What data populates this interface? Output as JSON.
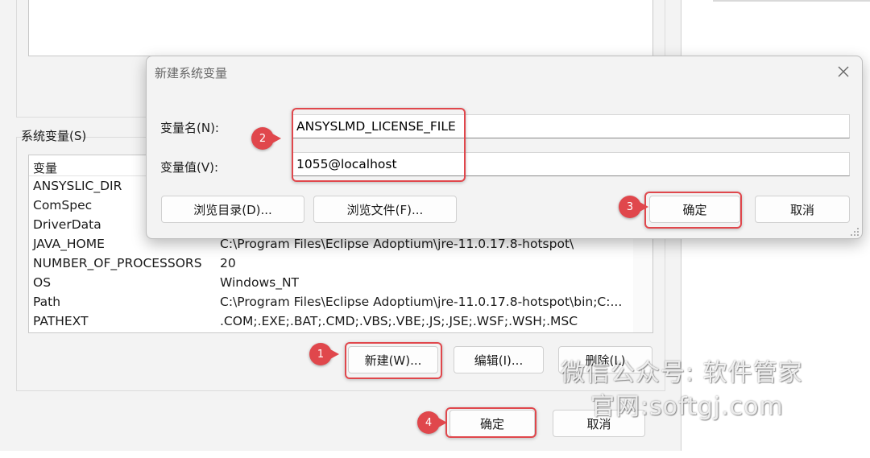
{
  "parent": {
    "section_label": "系统变量(S)",
    "column_header": "变量",
    "rows": [
      {
        "name": "ANSYSLIC_DIR",
        "value": ""
      },
      {
        "name": "ComSpec",
        "value": ""
      },
      {
        "name": "DriverData",
        "value": ""
      },
      {
        "name": "JAVA_HOME",
        "value": "C:\\Program Files\\Eclipse Adoptium\\jre-11.0.17.8-hotspot\\"
      },
      {
        "name": "NUMBER_OF_PROCESSORS",
        "value": "20"
      },
      {
        "name": "OS",
        "value": "Windows_NT"
      },
      {
        "name": "Path",
        "value": "C:\\Program Files\\Eclipse Adoptium\\jre-11.0.17.8-hotspot\\bin;C:..."
      },
      {
        "name": "PATHEXT",
        "value": ".COM;.EXE;.BAT;.CMD;.VBS;.VBE;.JS;.JSE;.WSF;.WSH;.MSC"
      }
    ],
    "new_button": "新建(W)...",
    "edit_button": "编辑(I)...",
    "delete_button": "删除(L)",
    "ok_button": "确定",
    "cancel_button": "取消"
  },
  "dialog": {
    "title": "新建系统变量",
    "name_label": "变量名(N):",
    "name_value": "ANSYSLMD_LICENSE_FILE",
    "value_label": "变量值(V):",
    "value_value": "1055@localhost",
    "browse_dir_button": "浏览目录(D)...",
    "browse_file_button": "浏览文件(F)...",
    "ok_button": "确定",
    "cancel_button": "取消"
  },
  "steps": [
    "1",
    "2",
    "3",
    "4"
  ],
  "watermark": {
    "line1": "微信公众号: 软件管家",
    "line2": "官网:softgj.com"
  },
  "colors": {
    "highlight": "#e0474c",
    "window_bg": "#f3f3f3"
  }
}
